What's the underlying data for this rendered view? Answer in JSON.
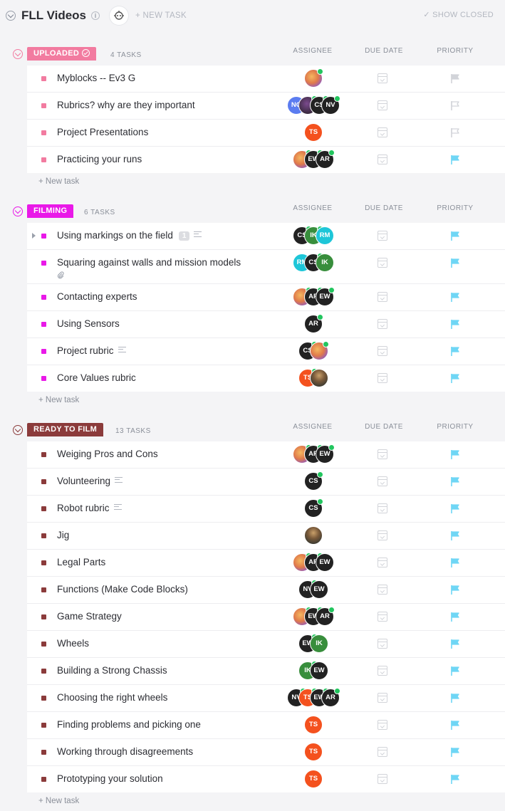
{
  "header": {
    "title": "FLL Videos",
    "info_glyph": "i",
    "new_task_label": "+ NEW TASK",
    "show_closed_label": "✓ SHOW CLOSED"
  },
  "columns": {
    "assignee": "ASSIGNEE",
    "due_date": "DUE DATE",
    "priority": "PRIORITY"
  },
  "new_task_row_label": "+ New task",
  "colors": {
    "uploaded": "#f27ba0",
    "filming": "#e919e8",
    "ready_to_film": "#8b3b3b",
    "priority_flag_blue": "#6fd6f5",
    "priority_flag_grey": "#d2d4d9",
    "online": "#22c55e"
  },
  "groups": [
    {
      "status": "UPLOADED",
      "count": "4 TASKS",
      "color": "#f27ba0",
      "tasks": [
        {
          "name": "Myblocks -- Ev3 G",
          "assignees": [
            {
              "kind": "photo",
              "online": true
            }
          ],
          "priority": "grey"
        },
        {
          "name": "Rubrics? why are they important",
          "assignees": [
            {
              "initials": "NG",
              "color": "#5b7cf0",
              "online": false
            },
            {
              "kind": "photo3",
              "online": true
            },
            {
              "initials": "CS",
              "color": "#222",
              "online": true
            },
            {
              "initials": "NV",
              "color": "#222",
              "online": true
            }
          ],
          "priority": "outline"
        },
        {
          "name": "Project Presentations",
          "assignees": [
            {
              "initials": "TS",
              "color": "#f4511e",
              "online": false
            }
          ],
          "priority": "outline"
        },
        {
          "name": "Practicing your runs",
          "assignees": [
            {
              "kind": "photo",
              "online": true
            },
            {
              "initials": "EW",
              "color": "#222",
              "online": true
            },
            {
              "initials": "AR",
              "color": "#222",
              "online": true
            }
          ],
          "priority": "blue"
        }
      ]
    },
    {
      "status": "FILMING",
      "count": "6 TASKS",
      "color": "#e919e8",
      "tasks": [
        {
          "name": "Using markings on the field",
          "subtasks": "1",
          "has_desc": true,
          "expandable": true,
          "assignees": [
            {
              "initials": "CS",
              "color": "#222",
              "online": true
            },
            {
              "initials": "IK",
              "color": "#388e3c",
              "online": true
            },
            {
              "initials": "RM",
              "color": "#1ec6d8",
              "online": false
            }
          ],
          "priority": "blue"
        },
        {
          "name": "Squaring against walls and mission models",
          "attachment": true,
          "assignees": [
            {
              "initials": "RM",
              "color": "#1ec6d8",
              "online": false
            },
            {
              "initials": "CS",
              "color": "#222",
              "online": true
            },
            {
              "initials": "IK",
              "color": "#388e3c",
              "online": false
            }
          ],
          "priority": "blue"
        },
        {
          "name": "Contacting experts",
          "assignees": [
            {
              "kind": "photo",
              "online": true
            },
            {
              "initials": "AR",
              "color": "#222",
              "online": true
            },
            {
              "initials": "EW",
              "color": "#222",
              "online": true
            }
          ],
          "priority": "blue"
        },
        {
          "name": "Using Sensors",
          "assignees": [
            {
              "initials": "AR",
              "color": "#222",
              "online": true
            }
          ],
          "priority": "blue"
        },
        {
          "name": "Project rubric",
          "has_desc": true,
          "assignees": [
            {
              "initials": "CS",
              "color": "#222",
              "online": true
            },
            {
              "kind": "photo",
              "online": true
            }
          ],
          "priority": "blue"
        },
        {
          "name": "Core Values rubric",
          "assignees": [
            {
              "initials": "TS",
              "color": "#f4511e",
              "online": true
            },
            {
              "kind": "photo2",
              "online": false
            }
          ],
          "priority": "blue"
        }
      ]
    },
    {
      "status": "READY TO FILM",
      "count": "13 TASKS",
      "color": "#8b3b3b",
      "tasks": [
        {
          "name": "Weiging Pros and Cons",
          "assignees": [
            {
              "kind": "photo",
              "online": true
            },
            {
              "initials": "AR",
              "color": "#222",
              "online": true
            },
            {
              "initials": "EW",
              "color": "#222",
              "online": true
            }
          ],
          "priority": "blue"
        },
        {
          "name": "Volunteering",
          "has_desc": true,
          "assignees": [
            {
              "initials": "CS",
              "color": "#222",
              "online": true
            }
          ],
          "priority": "blue"
        },
        {
          "name": "Robot rubric",
          "has_desc": true,
          "assignees": [
            {
              "initials": "CS",
              "color": "#222",
              "online": true
            }
          ],
          "priority": "blue"
        },
        {
          "name": "Jig",
          "assignees": [
            {
              "kind": "photo2",
              "online": false
            }
          ],
          "priority": "blue"
        },
        {
          "name": "Legal Parts",
          "assignees": [
            {
              "kind": "photo",
              "online": true
            },
            {
              "initials": "AR",
              "color": "#222",
              "online": true
            },
            {
              "initials": "EW",
              "color": "#222",
              "online": false
            }
          ],
          "priority": "blue"
        },
        {
          "name": "Functions (Make Code Blocks)",
          "assignees": [
            {
              "initials": "NV",
              "color": "#222",
              "online": true
            },
            {
              "initials": "EW",
              "color": "#222",
              "online": false
            }
          ],
          "priority": "blue"
        },
        {
          "name": "Game Strategy",
          "assignees": [
            {
              "kind": "photo",
              "online": true
            },
            {
              "initials": "EW",
              "color": "#222",
              "online": true
            },
            {
              "initials": "AR",
              "color": "#222",
              "online": true
            }
          ],
          "priority": "blue"
        },
        {
          "name": "Wheels",
          "assignees": [
            {
              "initials": "EW",
              "color": "#222",
              "online": true
            },
            {
              "initials": "IK",
              "color": "#388e3c",
              "online": false
            }
          ],
          "priority": "blue"
        },
        {
          "name": "Building a Strong Chassis",
          "assignees": [
            {
              "initials": "IK",
              "color": "#388e3c",
              "online": true
            },
            {
              "initials": "EW",
              "color": "#222",
              "online": false
            }
          ],
          "priority": "blue"
        },
        {
          "name": "Choosing the right wheels",
          "assignees": [
            {
              "initials": "NV",
              "color": "#222",
              "online": true
            },
            {
              "initials": "TS",
              "color": "#f4511e",
              "online": true
            },
            {
              "initials": "EW",
              "color": "#222",
              "online": true
            },
            {
              "initials": "AR",
              "color": "#222",
              "online": true
            }
          ],
          "priority": "blue"
        },
        {
          "name": "Finding problems and picking one",
          "assignees": [
            {
              "initials": "TS",
              "color": "#f4511e",
              "online": false
            }
          ],
          "priority": "blue"
        },
        {
          "name": "Working through disagreements",
          "assignees": [
            {
              "initials": "TS",
              "color": "#f4511e",
              "online": false
            }
          ],
          "priority": "blue"
        },
        {
          "name": "Prototyping your solution",
          "assignees": [
            {
              "initials": "TS",
              "color": "#f4511e",
              "online": false
            }
          ],
          "priority": "blue"
        }
      ]
    }
  ]
}
